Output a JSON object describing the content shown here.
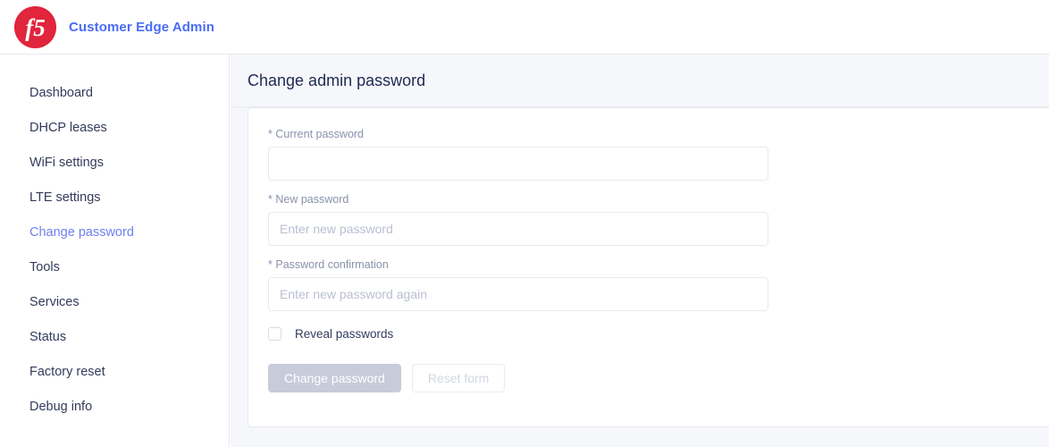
{
  "header": {
    "logo_icon": "f5-logo-icon",
    "logo_text": "f5",
    "brand_title": "Customer Edge Admin",
    "brand_color": "#4a6cf5",
    "logo_color": "#e0253c"
  },
  "sidebar": {
    "items": [
      {
        "label": "Dashboard",
        "active": false
      },
      {
        "label": "DHCP leases",
        "active": false
      },
      {
        "label": "WiFi settings",
        "active": false
      },
      {
        "label": "LTE settings",
        "active": false
      },
      {
        "label": "Change password",
        "active": true
      },
      {
        "label": "Tools",
        "active": false
      },
      {
        "label": "Services",
        "active": false
      },
      {
        "label": "Status",
        "active": false
      },
      {
        "label": "Factory reset",
        "active": false
      },
      {
        "label": "Debug info",
        "active": false
      }
    ],
    "active_color": "#6f80f0",
    "item_color": "#333b5c"
  },
  "main": {
    "page_title": "Change admin password",
    "form": {
      "fields": [
        {
          "label": "Current password",
          "required_marker": "*",
          "value": "",
          "placeholder": ""
        },
        {
          "label": "New password",
          "required_marker": "*",
          "value": "",
          "placeholder": "Enter new password"
        },
        {
          "label": "Password confirmation",
          "required_marker": "*",
          "value": "",
          "placeholder": "Enter new password again"
        }
      ],
      "reveal_checkbox": {
        "label": "Reveal passwords",
        "checked": false
      },
      "buttons": {
        "submit_label": "Change password",
        "submit_disabled": true,
        "reset_label": "Reset form",
        "reset_disabled": true
      }
    }
  }
}
